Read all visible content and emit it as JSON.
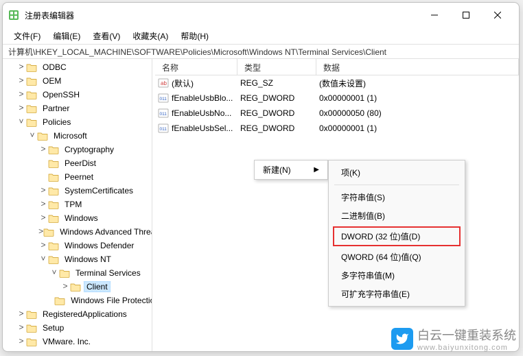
{
  "window": {
    "title": "注册表编辑器"
  },
  "menubar": [
    "文件(F)",
    "编辑(E)",
    "查看(V)",
    "收藏夹(A)",
    "帮助(H)"
  ],
  "address": "计算机\\HKEY_LOCAL_MACHINE\\SOFTWARE\\Policies\\Microsoft\\Windows NT\\Terminal Services\\Client",
  "columns": {
    "name": "名称",
    "type": "类型",
    "data": "数据"
  },
  "rows": [
    {
      "icon": "str",
      "name": "(默认)",
      "type": "REG_SZ",
      "data": "(数值未设置)"
    },
    {
      "icon": "bin",
      "name": "fEnableUsbBlo...",
      "type": "REG_DWORD",
      "data": "0x00000001 (1)"
    },
    {
      "icon": "bin",
      "name": "fEnableUsbNo...",
      "type": "REG_DWORD",
      "data": "0x00000050 (80)"
    },
    {
      "icon": "bin",
      "name": "fEnableUsbSel...",
      "type": "REG_DWORD",
      "data": "0x00000001 (1)"
    }
  ],
  "tree": [
    {
      "d": 1,
      "e": ">",
      "t": "ODBC"
    },
    {
      "d": 1,
      "e": ">",
      "t": "OEM"
    },
    {
      "d": 1,
      "e": ">",
      "t": "OpenSSH"
    },
    {
      "d": 1,
      "e": ">",
      "t": "Partner"
    },
    {
      "d": 1,
      "e": "v",
      "t": "Policies"
    },
    {
      "d": 2,
      "e": "v",
      "t": "Microsoft"
    },
    {
      "d": 3,
      "e": ">",
      "t": "Cryptography"
    },
    {
      "d": 3,
      "e": " ",
      "t": "PeerDist"
    },
    {
      "d": 3,
      "e": " ",
      "t": "Peernet"
    },
    {
      "d": 3,
      "e": ">",
      "t": "SystemCertificates"
    },
    {
      "d": 3,
      "e": ">",
      "t": "TPM"
    },
    {
      "d": 3,
      "e": ">",
      "t": "Windows"
    },
    {
      "d": 3,
      "e": ">",
      "t": "Windows Advanced Threat Protection"
    },
    {
      "d": 3,
      "e": ">",
      "t": "Windows Defender"
    },
    {
      "d": 3,
      "e": "v",
      "t": "Windows NT"
    },
    {
      "d": 4,
      "e": "v",
      "t": "Terminal Services"
    },
    {
      "d": 5,
      "e": ">",
      "t": "Client",
      "sel": true
    },
    {
      "d": 4,
      "e": " ",
      "t": "Windows File Protection"
    },
    {
      "d": 1,
      "e": ">",
      "t": "RegisteredApplications"
    },
    {
      "d": 1,
      "e": ">",
      "t": "Setup"
    },
    {
      "d": 1,
      "e": ">",
      "t": "VMware. Inc."
    }
  ],
  "ctx_sub": {
    "label": "新建(N)"
  },
  "ctx_main": [
    {
      "t": "项(K)",
      "k": "key"
    },
    {
      "sep": true
    },
    {
      "t": "字符串值(S)",
      "k": "string"
    },
    {
      "t": "二进制值(B)",
      "k": "binary"
    },
    {
      "t": "DWORD (32 位)值(D)",
      "k": "dword",
      "hl": true
    },
    {
      "t": "QWORD (64 位)值(Q)",
      "k": "qword"
    },
    {
      "t": "多字符串值(M)",
      "k": "multi"
    },
    {
      "t": "可扩充字符串值(E)",
      "k": "expand"
    }
  ],
  "watermark": {
    "brand": "白云一键重装系统",
    "url": "www.baiyunxitong.com"
  }
}
